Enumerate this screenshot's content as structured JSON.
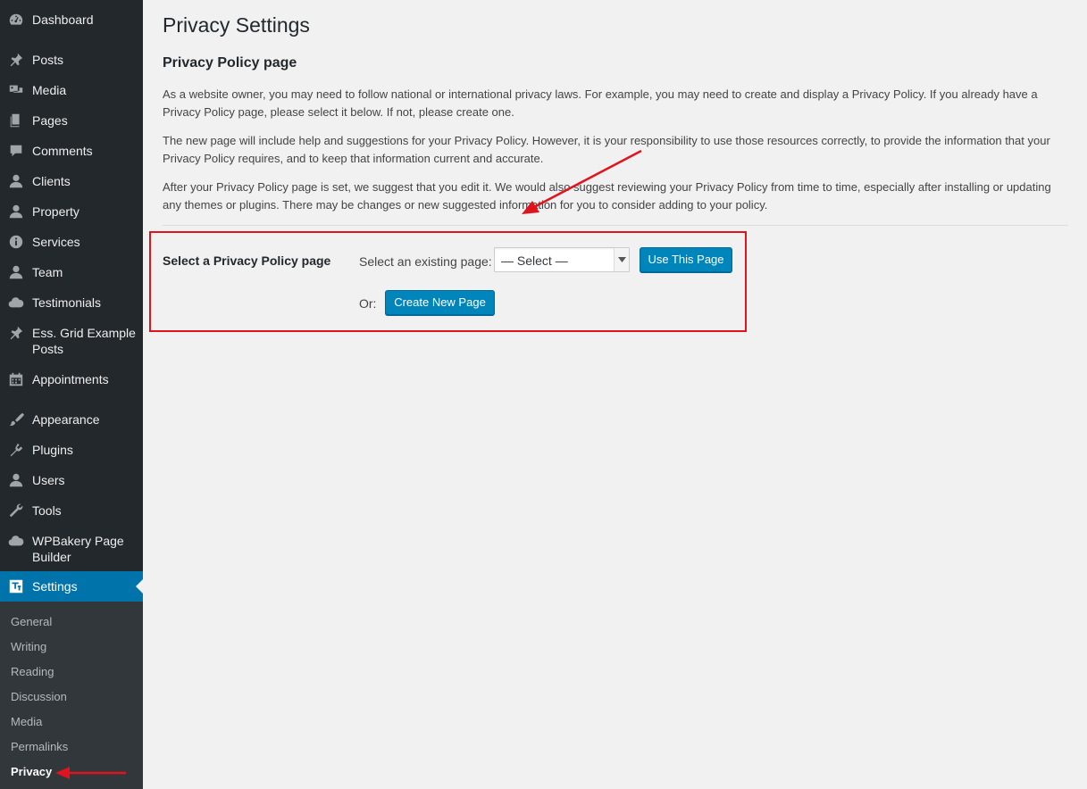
{
  "sidebar": {
    "items": [
      {
        "label": "Dashboard",
        "icon": "dashboard-icon"
      },
      {
        "label": "Posts",
        "icon": "pin-icon"
      },
      {
        "label": "Media",
        "icon": "media-icon"
      },
      {
        "label": "Pages",
        "icon": "pages-icon"
      },
      {
        "label": "Comments",
        "icon": "comment-icon"
      },
      {
        "label": "Clients",
        "icon": "user-icon"
      },
      {
        "label": "Property",
        "icon": "user-icon"
      },
      {
        "label": "Services",
        "icon": "info-icon"
      },
      {
        "label": "Team",
        "icon": "user-icon"
      },
      {
        "label": "Testimonials",
        "icon": "cloud-icon"
      },
      {
        "label": "Ess. Grid Example Posts",
        "label_line1": "Ess. Grid Example",
        "label_line2": "Posts",
        "icon": "pin-icon"
      },
      {
        "label": "Appointments",
        "icon": "calendar-icon"
      },
      {
        "label": "Appearance",
        "icon": "brush-icon"
      },
      {
        "label": "Plugins",
        "icon": "plugin-icon"
      },
      {
        "label": "Users",
        "icon": "user-icon"
      },
      {
        "label": "Tools",
        "icon": "wrench-icon"
      },
      {
        "label": "WPBakery Page Builder",
        "label_line1": "WPBakery Page",
        "label_line2": "Builder",
        "icon": "cloud-icon"
      },
      {
        "label": "Settings",
        "icon": "settings-icon",
        "current": true
      }
    ],
    "submenu": [
      {
        "label": "General"
      },
      {
        "label": "Writing"
      },
      {
        "label": "Reading"
      },
      {
        "label": "Discussion"
      },
      {
        "label": "Media"
      },
      {
        "label": "Permalinks"
      },
      {
        "label": "Privacy",
        "current": true
      }
    ]
  },
  "main": {
    "title": "Privacy Settings",
    "section_title": "Privacy Policy page",
    "paragraphs": [
      "As a website owner, you may need to follow national or international privacy laws. For example, you may need to create and display a Privacy Policy. If you already have a Privacy Policy page, please select it below. If not, please create one.",
      "The new page will include help and suggestions for your Privacy Policy. However, it is your responsibility to use those resources correctly, to provide the information that your Privacy Policy requires, and to keep that information current and accurate.",
      "After your Privacy Policy page is set, we suggest that you edit it. We would also suggest reviewing your Privacy Policy from time to time, especially after installing or updating any themes or plugins. There may be changes or new suggested information for you to consider adding to your policy."
    ],
    "form": {
      "row_label": "Select a Privacy Policy page",
      "select_label": "Select an existing page:",
      "select_value": "— Select —",
      "use_button": "Use This Page",
      "or_label": "Or:",
      "create_button": "Create New Page"
    }
  },
  "colors": {
    "sidebar_bg": "#23282d",
    "submenu_bg": "#32373c",
    "accent": "#0073aa",
    "button": "#0085ba",
    "annotation": "#e0141e"
  }
}
